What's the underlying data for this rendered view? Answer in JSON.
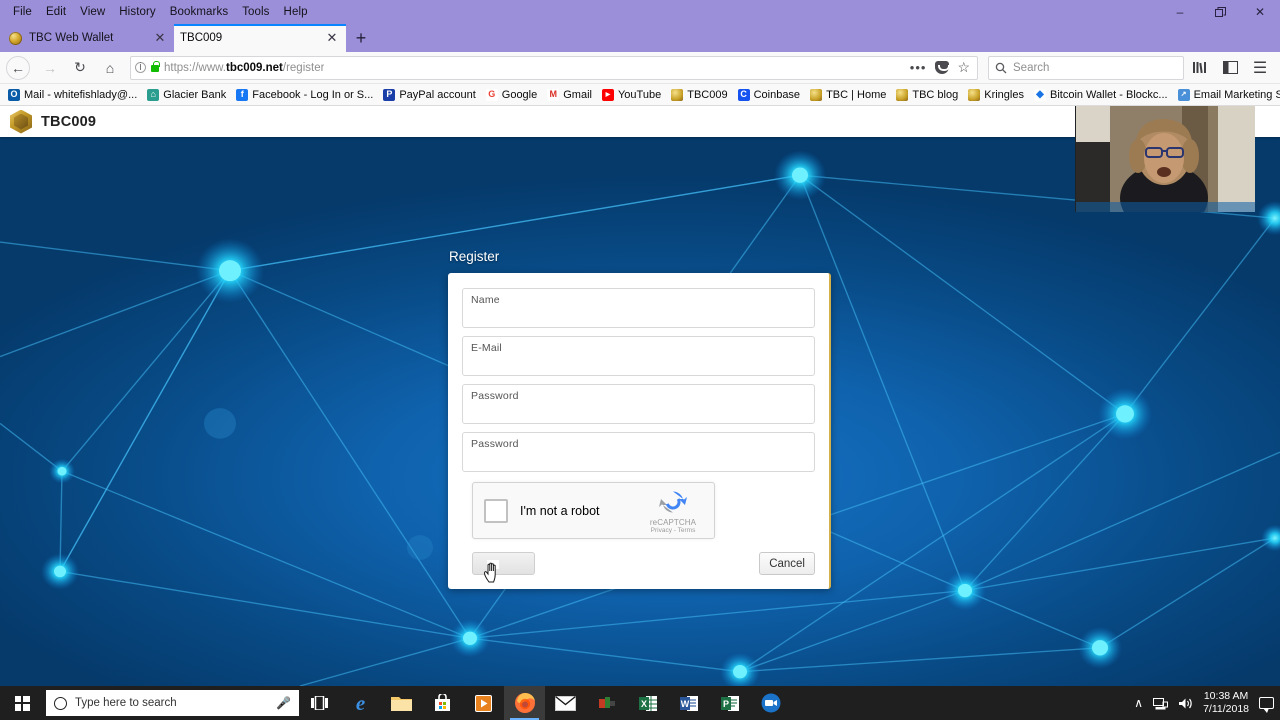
{
  "browser": {
    "menus": [
      "File",
      "Edit",
      "View",
      "History",
      "Bookmarks",
      "Tools",
      "Help"
    ],
    "window_controls": {
      "minimize": "–",
      "restore": "❐",
      "close": "✕"
    },
    "tabs": [
      {
        "label": "TBC Web Wallet",
        "close": "✕",
        "active": false
      },
      {
        "label": "TBC009",
        "close": "✕",
        "active": true
      }
    ],
    "new_tab": "+",
    "nav": {
      "back": "←",
      "forward": "→",
      "reload": "↻",
      "home": "⌂"
    },
    "url": {
      "prefix": "https://www.",
      "host": "tbc009.net",
      "path": "/register",
      "info": "i"
    },
    "url_actions": {
      "page_actions": "•••",
      "pocket": "pocket",
      "bookmark_star": "☆"
    },
    "search": {
      "placeholder": "Search",
      "icon": "⌕"
    },
    "toolbar_right": {
      "library": "library",
      "sidebar": "sidebar",
      "menu": "☰"
    },
    "bookmarks": [
      {
        "label": "Mail - whitefishlady@...",
        "icon_text": "O",
        "icon_color": "#0a5ca8"
      },
      {
        "label": "Glacier Bank",
        "icon_text": "⌂",
        "icon_color": "#2a9d8f"
      },
      {
        "label": "Facebook - Log In or S...",
        "icon_text": "f",
        "icon_color": "#1877f2"
      },
      {
        "label": "PayPal account",
        "icon_text": "P",
        "icon_color": "#1a3ea8"
      },
      {
        "label": "Google",
        "icon_text": "G",
        "icon_color": "#ea4335"
      },
      {
        "label": "Gmail",
        "icon_text": "M",
        "icon_color": "#d93025"
      },
      {
        "label": "YouTube",
        "icon_text": "▶",
        "icon_color": "#ff0000"
      },
      {
        "label": "TBC009",
        "icon_text": "",
        "icon_color": "#c9a227"
      },
      {
        "label": "Coinbase",
        "icon_text": "C",
        "icon_color": "#1652f0"
      },
      {
        "label": "TBC | Home",
        "icon_text": "",
        "icon_color": "#c9a227"
      },
      {
        "label": "TBC blog",
        "icon_text": "",
        "icon_color": "#c9a227"
      },
      {
        "label": "Kringles",
        "icon_text": "",
        "icon_color": "#c9a227"
      },
      {
        "label": "Bitcoin Wallet - Blockc...",
        "icon_text": "◆",
        "icon_color": "#1b74e4"
      },
      {
        "label": "Email Marketing Softw...",
        "icon_text": "↗",
        "icon_color": "#4a90d9"
      }
    ],
    "bookmarks_overflow": "»"
  },
  "site": {
    "logo_name": "tbc-hex-coin-logo",
    "title": "TBC009"
  },
  "register": {
    "heading": "Register",
    "fields": [
      {
        "label": "Name",
        "value": "",
        "type": "text"
      },
      {
        "label": "E-Mail",
        "value": "",
        "type": "email"
      },
      {
        "label": "Password",
        "value": "",
        "type": "password"
      },
      {
        "label": "Password",
        "value": "",
        "type": "password"
      }
    ],
    "recaptcha": {
      "checkbox_label": "I'm not a robot",
      "brand": "reCAPTCHA",
      "terms": "Privacy - Terms"
    },
    "submit_label": "",
    "cancel_label": "Cancel"
  },
  "taskbar": {
    "search_placeholder": "Type here to search",
    "apps": [
      {
        "name": "task-view",
        "glyph": "☰"
      },
      {
        "name": "microsoft-edge",
        "glyph": "e"
      },
      {
        "name": "file-explorer",
        "glyph": "🗀"
      },
      {
        "name": "microsoft-store",
        "glyph": "🛍"
      },
      {
        "name": "media-player",
        "glyph": "▶"
      },
      {
        "name": "firefox",
        "glyph": "🦊"
      },
      {
        "name": "mail",
        "glyph": "✉"
      },
      {
        "name": "pinned-app",
        "glyph": "■"
      },
      {
        "name": "excel",
        "glyph": "X"
      },
      {
        "name": "word",
        "glyph": "W"
      },
      {
        "name": "powerpoint",
        "glyph": "P"
      },
      {
        "name": "video-call-app",
        "glyph": "●"
      }
    ],
    "tray": {
      "chevron": "∧",
      "network": "🖧",
      "volume": "🔊"
    },
    "clock": {
      "time": "10:38 AM",
      "date": "7/11/2018"
    }
  },
  "colors": {
    "chrome_purple": "#9a8fd8",
    "page_blue": "#0f62ad",
    "node_cyan": "#24e0ff",
    "gold": "#c9a227",
    "taskbar": "#1f1f1f"
  }
}
